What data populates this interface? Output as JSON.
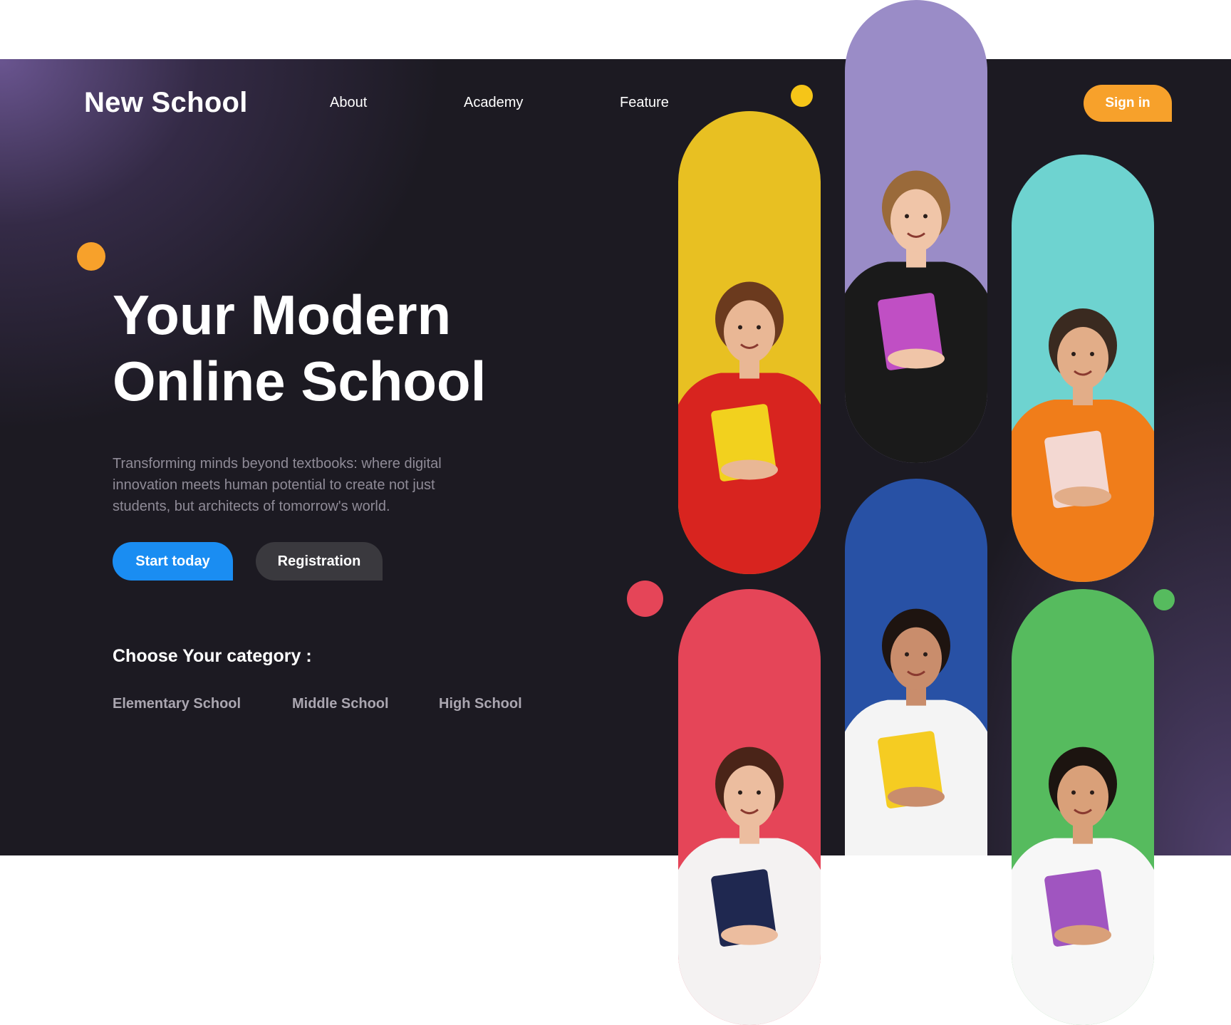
{
  "header": {
    "logo": "New School",
    "nav": [
      {
        "label": "About"
      },
      {
        "label": "Academy"
      },
      {
        "label": "Feature"
      }
    ],
    "signin_label": "Sign in"
  },
  "hero": {
    "title_line1": "Your Modern",
    "title_line2": "Online School",
    "subtitle": "Transforming minds beyond textbooks: where digital innovation meets human potential to create not just students, but architects of tomorrow's world.",
    "start_label": "Start today",
    "registration_label": "Registration"
  },
  "categories": {
    "heading": "Choose Your category :",
    "items": [
      {
        "label": "Elementary School"
      },
      {
        "label": "Middle School"
      },
      {
        "label": "High School"
      }
    ]
  },
  "gallery": {
    "photos": [
      {
        "name": "student-curly-hair-red-hoodie",
        "background": "#e8c022",
        "hair": "#6b3a1e",
        "skin": "#e9b795",
        "shirt": "#d8241f",
        "prop": "#f2d11e"
      },
      {
        "name": "student-short-hair-plaid-shirt",
        "background": "#9a8cc7",
        "hair": "#9a6a3a",
        "skin": "#f0c5a8",
        "shirt": "#1a1a1a",
        "prop": "#c04fc4"
      },
      {
        "name": "student-beard-orange-sweater",
        "background": "#6ed3d0",
        "hair": "#3a2a20",
        "skin": "#e2ad88",
        "shirt": "#f07d1a",
        "prop": "#f3d8d2"
      },
      {
        "name": "student-long-hair-white-blouse",
        "background": "#e54558",
        "hair": "#4a2418",
        "skin": "#ecbd9f",
        "shirt": "#f4f2f2",
        "prop": "#1f2850"
      },
      {
        "name": "student-curly-hair-green-shirt",
        "background": "#2851a5",
        "hair": "#1e1410",
        "skin": "#c98d6c",
        "shirt": "#f4f4f4",
        "prop": "#f5cc22"
      },
      {
        "name": "student-dark-hair-white-polo",
        "background": "#56bb5e",
        "hair": "#1c1410",
        "skin": "#d9a079",
        "shirt": "#f7f7f7",
        "prop": "#a055c0"
      }
    ]
  },
  "accents": {
    "orange": "#f7a12b",
    "yellow": "#f5c518",
    "red": "#e54558",
    "green": "#56bb5e",
    "blue": "#1a8df2"
  }
}
